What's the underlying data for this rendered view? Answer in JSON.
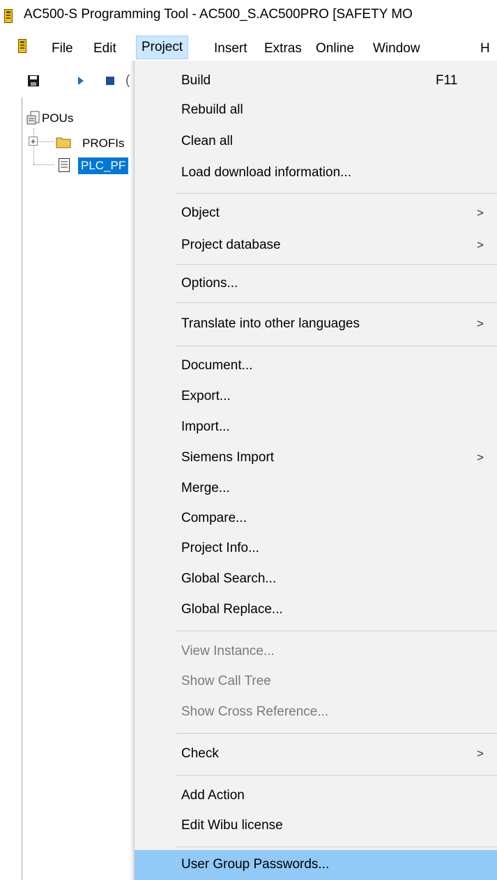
{
  "window": {
    "title": "AC500-S Programming Tool - AC500_S.AC500PRO [SAFETY MO",
    "app_icon": "yellow-plc-icon"
  },
  "menubar": {
    "items": [
      "File",
      "Edit",
      "Project",
      "Insert",
      "Extras",
      "Online",
      "Window",
      "H"
    ],
    "active": "Project"
  },
  "toolbar": {
    "icons": [
      "save-icon",
      "play-icon",
      "stop-icon"
    ],
    "partial_text": "("
  },
  "tree": {
    "root": "POUs",
    "child1": "PROFIs",
    "child2": "PLC_PF",
    "expander": "+"
  },
  "project_menu": {
    "items": [
      {
        "label": "Build",
        "shortcut": "F11"
      },
      {
        "label": "Rebuild all"
      },
      {
        "label": "Clean all"
      },
      {
        "label": "Load download information..."
      },
      {
        "label": "Object",
        "submenu": true
      },
      {
        "label": "Project database",
        "submenu": true
      },
      {
        "label": "Options..."
      },
      {
        "label": "Translate into other languages",
        "submenu": true
      },
      {
        "label": "Document..."
      },
      {
        "label": "Export..."
      },
      {
        "label": "Import..."
      },
      {
        "label": "Siemens Import",
        "submenu": true
      },
      {
        "label": "Merge..."
      },
      {
        "label": "Compare..."
      },
      {
        "label": "Project Info..."
      },
      {
        "label": "Global Search..."
      },
      {
        "label": "Global Replace..."
      },
      {
        "label": "View Instance...",
        "disabled": true
      },
      {
        "label": "Show Call Tree",
        "disabled": true
      },
      {
        "label": "Show Cross Reference...",
        "disabled": true
      },
      {
        "label": "Check",
        "submenu": true
      },
      {
        "label": "Add Action"
      },
      {
        "label": "Edit Wibu license"
      },
      {
        "label": "User Group Passwords...",
        "highlighted": true
      }
    ],
    "submenu_arrow": ">"
  },
  "colors": {
    "menu_bg": "#f2f2f2",
    "highlight": "#91c9f7",
    "tree_selection": "#0078d7",
    "menubar_active": "#cce8ff"
  }
}
